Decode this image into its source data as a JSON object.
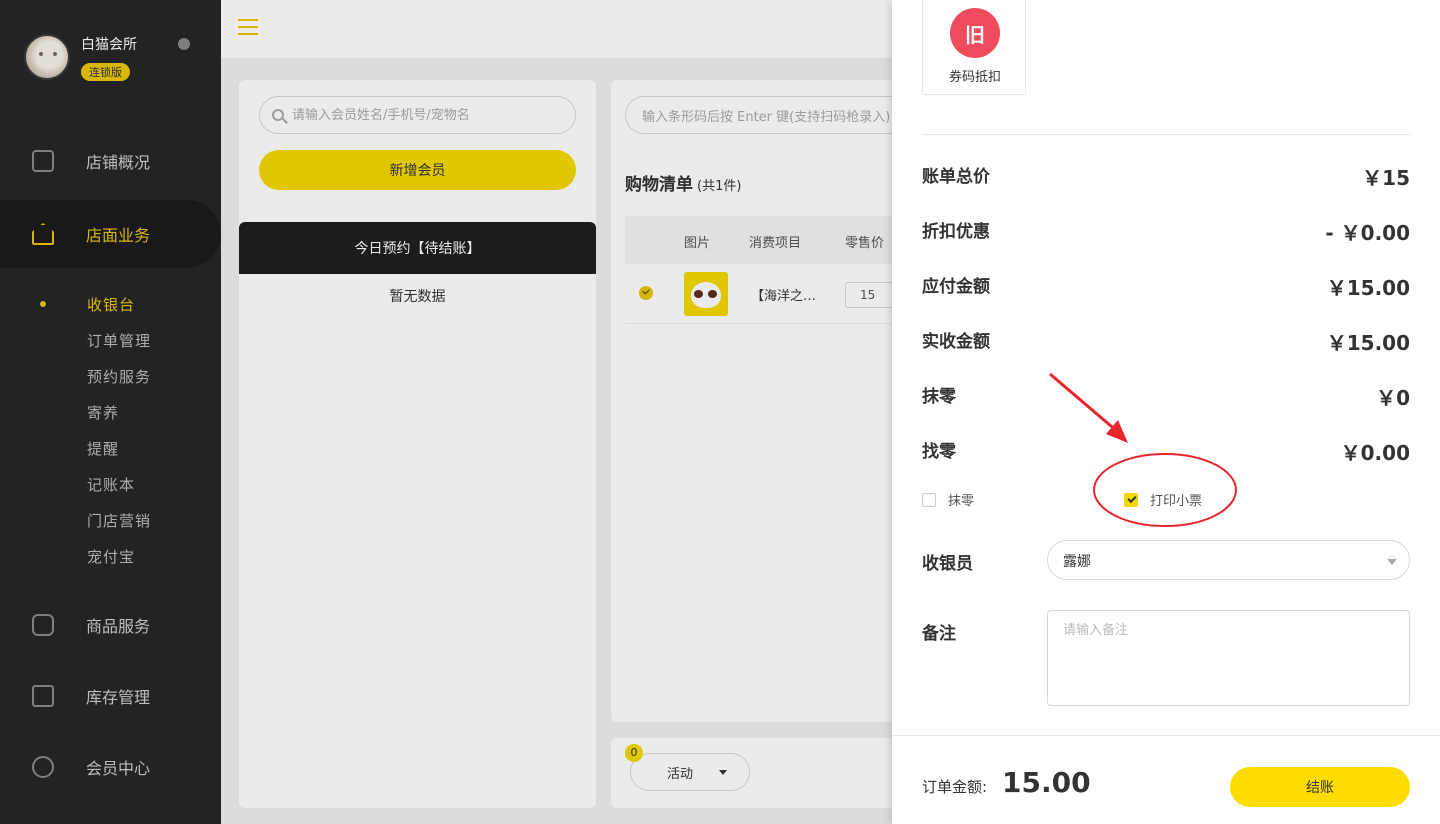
{
  "sidebar": {
    "shop_name": "白猫会所",
    "badge": "连锁版",
    "nav": [
      "店铺概况",
      "店面业务",
      "商品服务",
      "库存管理",
      "会员中心"
    ],
    "sub_items": [
      "收银台",
      "订单管理",
      "预约服务",
      "寄养",
      "提醒",
      "记账本",
      "门店营销",
      "宠付宝"
    ]
  },
  "member": {
    "search_placeholder": "请输入会员姓名/手机号/宠物名",
    "add_label": "新增会员",
    "appointments_title": "今日预约【待结账】",
    "no_data": "暂无数据"
  },
  "cart": {
    "barcode_placeholder": "输入条形码后按 Enter 键(支持扫码枪录入)",
    "title": "购物清单",
    "count": "(共1件)",
    "headers": [
      "图片",
      "消费项目",
      "零售价"
    ],
    "rows": [
      {
        "name": "【海洋之…",
        "price": "15"
      }
    ],
    "activity_badge": "0",
    "activity_label": "活动"
  },
  "drawer": {
    "coupon_icon_text": "旧",
    "coupon_label": "券码抵扣",
    "summary": [
      {
        "label": "账单总价",
        "value": "￥15"
      },
      {
        "label": "折扣优惠",
        "value": "- ￥0.00"
      },
      {
        "label": "应付金额",
        "value": "￥15.00"
      },
      {
        "label": "实收金额",
        "value": "￥15.00"
      },
      {
        "label": "抹零",
        "value": "￥0"
      },
      {
        "label": "找零",
        "value": "￥0.00"
      }
    ],
    "option_moling": "抹零",
    "option_print": "打印小票",
    "cashier_label": "收银员",
    "cashier_value": "露娜",
    "remark_label": "备注",
    "remark_placeholder": "请输入备注",
    "total_label": "订单金额:",
    "total_value": "15.00",
    "checkout_label": "结账"
  },
  "colors": {
    "accent": "#F5D800",
    "sidebar_bg": "#262626",
    "coupon_red": "#F04B5C",
    "annotation_red": "#E8262B"
  }
}
